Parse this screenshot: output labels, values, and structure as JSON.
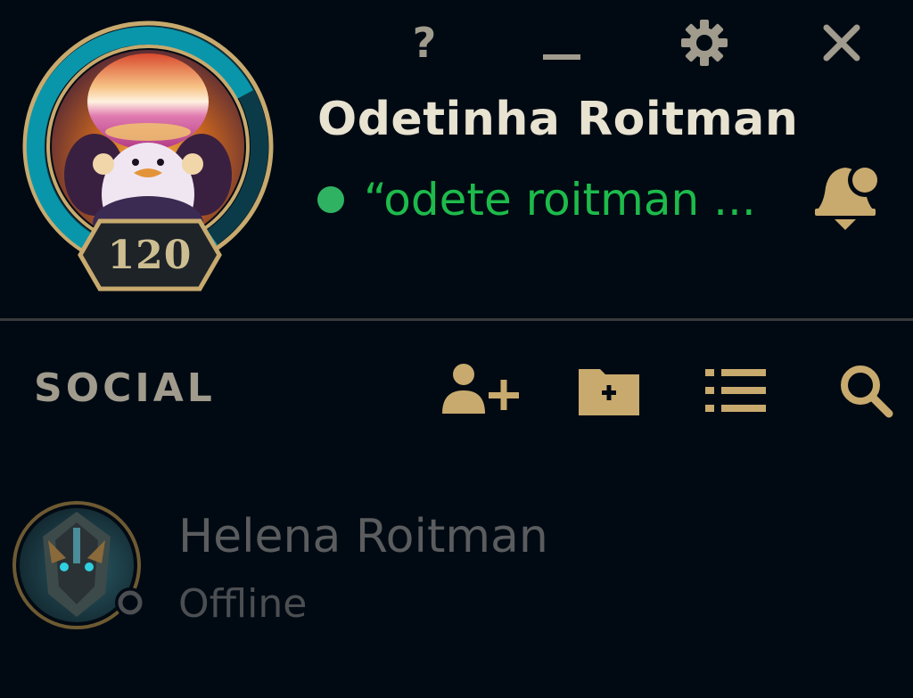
{
  "window_controls": {
    "help_label": "?",
    "minimize_icon": "minimize-icon",
    "settings_icon": "gear-icon",
    "close_icon": "close-icon"
  },
  "profile": {
    "name": "Odetinha Roitman",
    "level": "120",
    "status_message": "“odete roitman ...",
    "status": "online",
    "status_color": "#2fb363",
    "notification_icon": "bell-icon"
  },
  "social": {
    "title": "SOCIAL",
    "actions": [
      {
        "icon": "add-friend-icon"
      },
      {
        "icon": "add-folder-icon"
      },
      {
        "icon": "list-icon"
      },
      {
        "icon": "search-icon"
      }
    ]
  },
  "friends": [
    {
      "name": "Helena Roitman",
      "status": "Offline"
    }
  ],
  "colors": {
    "background": "#010a13",
    "gold": "#c8aa6e",
    "ring_teal": "#0a96aa",
    "online_green": "#1dbb4b",
    "offline_grey": "#5a5c5e"
  }
}
